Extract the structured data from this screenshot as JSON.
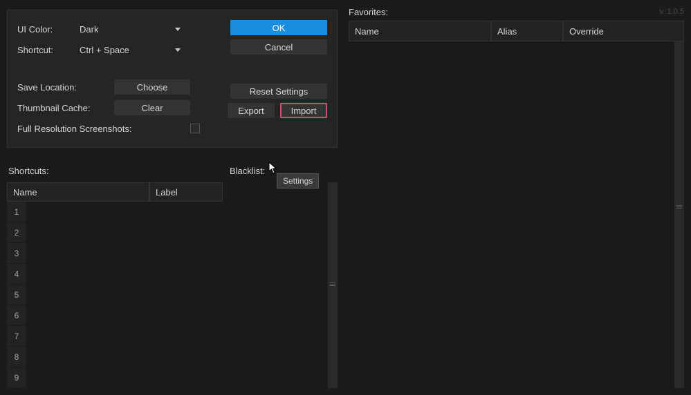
{
  "version": "v. 1.0.5",
  "settings": {
    "ui_color_label": "UI Color:",
    "ui_color_value": "Dark",
    "shortcut_label": "Shortcut:",
    "shortcut_value": "Ctrl + Space",
    "save_location_label": "Save Location:",
    "choose_label": "Choose",
    "thumbnail_cache_label": "Thumbnail Cache:",
    "clear_label": "Clear",
    "full_res_label": "Full Resolution Screenshots:",
    "full_res_checked": false,
    "ok_label": "OK",
    "cancel_label": "Cancel",
    "reset_label": "Reset Settings",
    "export_label": "Export",
    "import_label": "Import"
  },
  "shortcuts": {
    "title": "Shortcuts:",
    "columns": {
      "name": "Name",
      "label": "Label"
    },
    "rows": [
      1,
      2,
      3,
      4,
      5,
      6,
      7,
      8,
      9
    ]
  },
  "blacklist": {
    "title": "Blacklist:"
  },
  "favorites": {
    "title": "Favorites:",
    "columns": {
      "name": "Name",
      "alias": "Alias",
      "override": "Override"
    }
  },
  "tooltip": "Settings"
}
